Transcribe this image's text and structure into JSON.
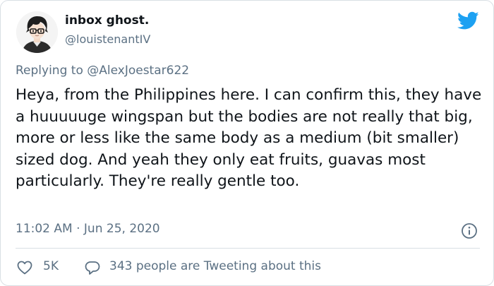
{
  "author": {
    "display_name": "inbox ghost.",
    "handle": "@louistenantIV"
  },
  "reply": {
    "prefix": "Replying to",
    "mention": "@AlexJoestar622"
  },
  "tweet": {
    "text": "Heya, from the Philippines here. I can confirm this, they have a huuuuuge wingspan but the bodies are not really that big, more or less like the same body as a medium (bit smaller) sized dog. And yeah they only eat fruits, guavas most particularly. They're really gentle too.",
    "time": "11:02 AM",
    "separator": "·",
    "date": "Jun 25, 2020"
  },
  "actions": {
    "likes": "5K",
    "conversation": "343 people are Tweeting about this"
  },
  "icons": {
    "brand": "twitter-bird-icon",
    "info": "info-icon",
    "like": "heart-icon",
    "reply": "speech-bubble-icon"
  },
  "colors": {
    "brand_blue": "#1da1f2",
    "text_primary": "#0f1419",
    "text_secondary": "#5b7083",
    "border": "#d9dfe4"
  }
}
